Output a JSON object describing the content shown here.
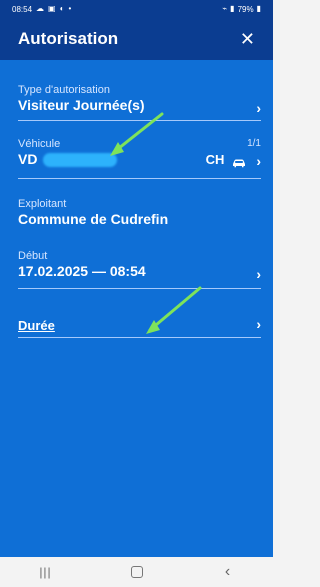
{
  "status": {
    "time": "08:54",
    "battery": "79%"
  },
  "header": {
    "title": "Autorisation",
    "close_icon": "close-icon"
  },
  "fields": {
    "type": {
      "label": "Type d'autorisation",
      "value": "Visiteur Journée(s)"
    },
    "vehicle": {
      "label": "Véhicule",
      "plate_prefix": "VD",
      "count": "1/1",
      "country": "CH"
    },
    "operator": {
      "label": "Exploitant",
      "value": "Commune de Cudrefin"
    },
    "start": {
      "label": "Début",
      "value": "17.02.2025 — 08:54"
    },
    "duration": {
      "label": "Durée"
    }
  },
  "colors": {
    "header_bg": "#0b3d91",
    "content_bg": "#0f6fd6",
    "accent_arrow": "#7ee35a"
  },
  "nav": {
    "recent_icon": "recent-apps-icon",
    "home_icon": "home-icon",
    "back_icon": "back-icon"
  }
}
